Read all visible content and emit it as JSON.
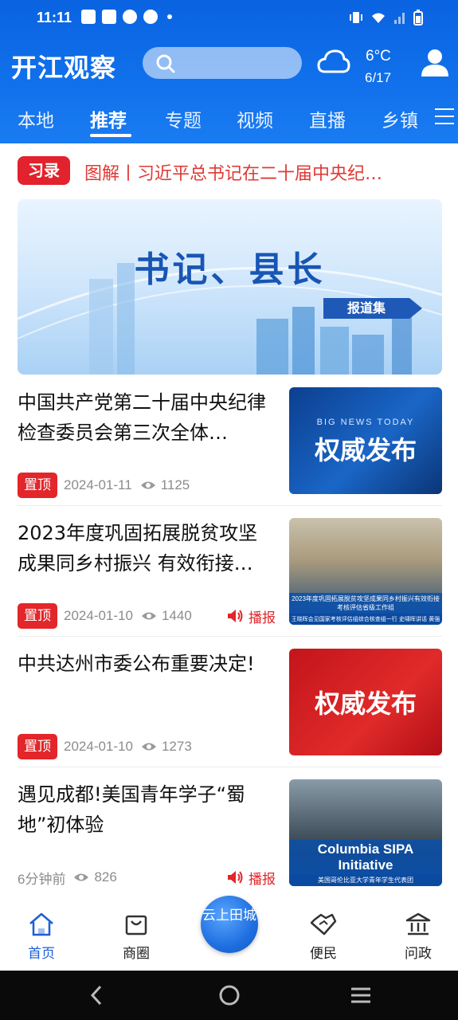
{
  "status": {
    "time": "11:11"
  },
  "header": {
    "logo": "开江观察",
    "weather": {
      "temp": "6°C",
      "date": "6/17"
    }
  },
  "tabs": [
    "本地",
    "推荐",
    "专题",
    "视频",
    "直播",
    "乡镇"
  ],
  "active_tab": "推荐",
  "xi": {
    "badge": "习录",
    "text": "图解丨习近平总书记在二十届中央纪…"
  },
  "banner": {
    "title": "书记、县长",
    "tag": "报道集"
  },
  "news": [
    {
      "title": "中国共产党第二十届中央纪律检查委员会第三次全体…",
      "pinned": "置顶",
      "date": "2024-01-11",
      "views": "1125",
      "broadcast": "",
      "thumb_big": "权威发布",
      "thumb_small": "BIG NEWS TODAY"
    },
    {
      "title": "2023年度巩固拓展脱贫攻坚成果同乡村振兴 有效衔接…",
      "pinned": "置顶",
      "date": "2024-01-10",
      "views": "1440",
      "broadcast": "播报",
      "thumb_caption": "2023年度巩固拓展脱贫攻坚成果同乡村振兴有效衔接考核评估省级工作组",
      "thumb_sub": "王晓晖会见国家考核评估组综合核查组一行 史啸晖讲话 黄强作表态发言"
    },
    {
      "title": "中共达州市委公布重要决定!",
      "pinned": "置顶",
      "date": "2024-01-10",
      "views": "1273",
      "broadcast": "",
      "thumb_big": "权威发布"
    },
    {
      "title": "遇见成都!美国青年学子“蜀地”初体验",
      "pinned": "",
      "date": "6分钟前",
      "views": "826",
      "broadcast": "播报",
      "thumb_caption": "Columbia SIPA Initiative",
      "thumb_sub": "美国哥伦比亚大学青年学生代表团"
    }
  ],
  "bottom_nav": {
    "home": "首页",
    "shop": "商圈",
    "center": "云上田城",
    "service": "便民",
    "ask": "问政"
  },
  "colors": {
    "primary": "#1171ec",
    "accent_red": "#e2262a"
  }
}
